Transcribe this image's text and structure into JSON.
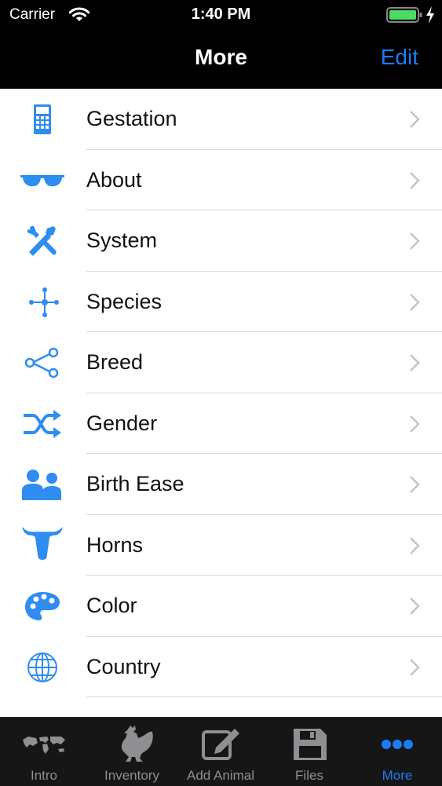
{
  "status": {
    "carrier": "Carrier",
    "time": "1:40 PM"
  },
  "nav": {
    "title": "More",
    "edit": "Edit"
  },
  "items": [
    {
      "label": "Gestation",
      "icon": "calculator-icon"
    },
    {
      "label": "About",
      "icon": "sunglasses-icon"
    },
    {
      "label": "System",
      "icon": "tools-icon"
    },
    {
      "label": "Species",
      "icon": "network-icon"
    },
    {
      "label": "Breed",
      "icon": "share-nodes-icon"
    },
    {
      "label": "Gender",
      "icon": "shuffle-icon"
    },
    {
      "label": "Birth Ease",
      "icon": "users-icon"
    },
    {
      "label": "Horns",
      "icon": "bull-head-icon"
    },
    {
      "label": "Color",
      "icon": "palette-icon"
    },
    {
      "label": "Country",
      "icon": "globe-icon"
    }
  ],
  "tabs": [
    {
      "label": "Intro",
      "icon": "world-map-icon"
    },
    {
      "label": "Inventory",
      "icon": "rooster-icon"
    },
    {
      "label": "Add Animal",
      "icon": "edit-square-icon"
    },
    {
      "label": "Files",
      "icon": "floppy-disk-icon"
    },
    {
      "label": "More",
      "icon": "more-dots-icon"
    }
  ],
  "colors": {
    "accent": "#1b7cf6",
    "icon_blue": "#2f8cf0",
    "tab_inactive": "#8e8e93"
  }
}
